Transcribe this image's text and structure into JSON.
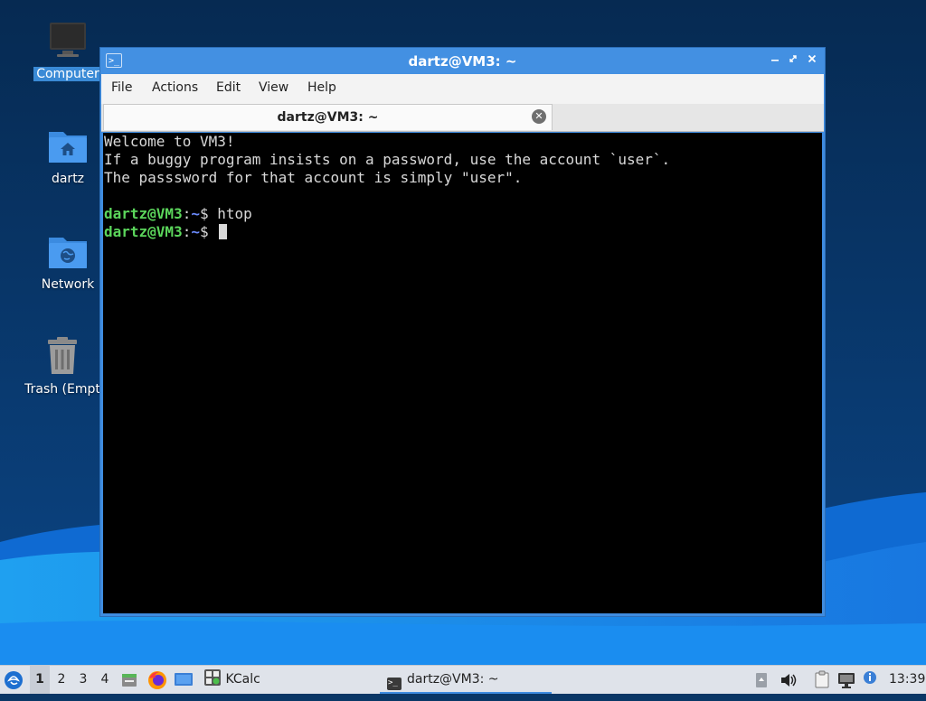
{
  "desktop": {
    "icons": [
      {
        "label": "Computer"
      },
      {
        "label": "dartz"
      },
      {
        "label": "Network"
      },
      {
        "label": "Trash (Empt"
      }
    ]
  },
  "window": {
    "title": "dartz@VM3: ~",
    "app_icon_text": ">_",
    "menu": [
      "File",
      "Actions",
      "Edit",
      "View",
      "Help"
    ],
    "tab_label": "dartz@VM3: ~",
    "terminal": {
      "lines": [
        "Welcome to VM3!",
        "If a buggy program insists on a password, use the account `user`.",
        "The passsword for that account is simply \"user\"."
      ],
      "prompt_user": "dartz@VM3",
      "prompt_sep": ":",
      "prompt_path": "~",
      "prompt_sym": "$",
      "commands": [
        "htop",
        ""
      ]
    }
  },
  "taskbar": {
    "desktops": [
      "1",
      "2",
      "3",
      "4"
    ],
    "active_desktop": "1",
    "launchers": [
      {
        "icon": "file-manager-icon"
      },
      {
        "icon": "firefox-icon"
      },
      {
        "icon": "show-desktop-icon"
      }
    ],
    "kcalc_label": "KCalc",
    "task_label": "dartz@VM3: ~",
    "clock": "13:39"
  },
  "colors": {
    "window_accent": "#3f8ce0",
    "prompt_user": "#5bd55b",
    "prompt_path": "#6c8cff",
    "terminal_bg": "#000000"
  }
}
